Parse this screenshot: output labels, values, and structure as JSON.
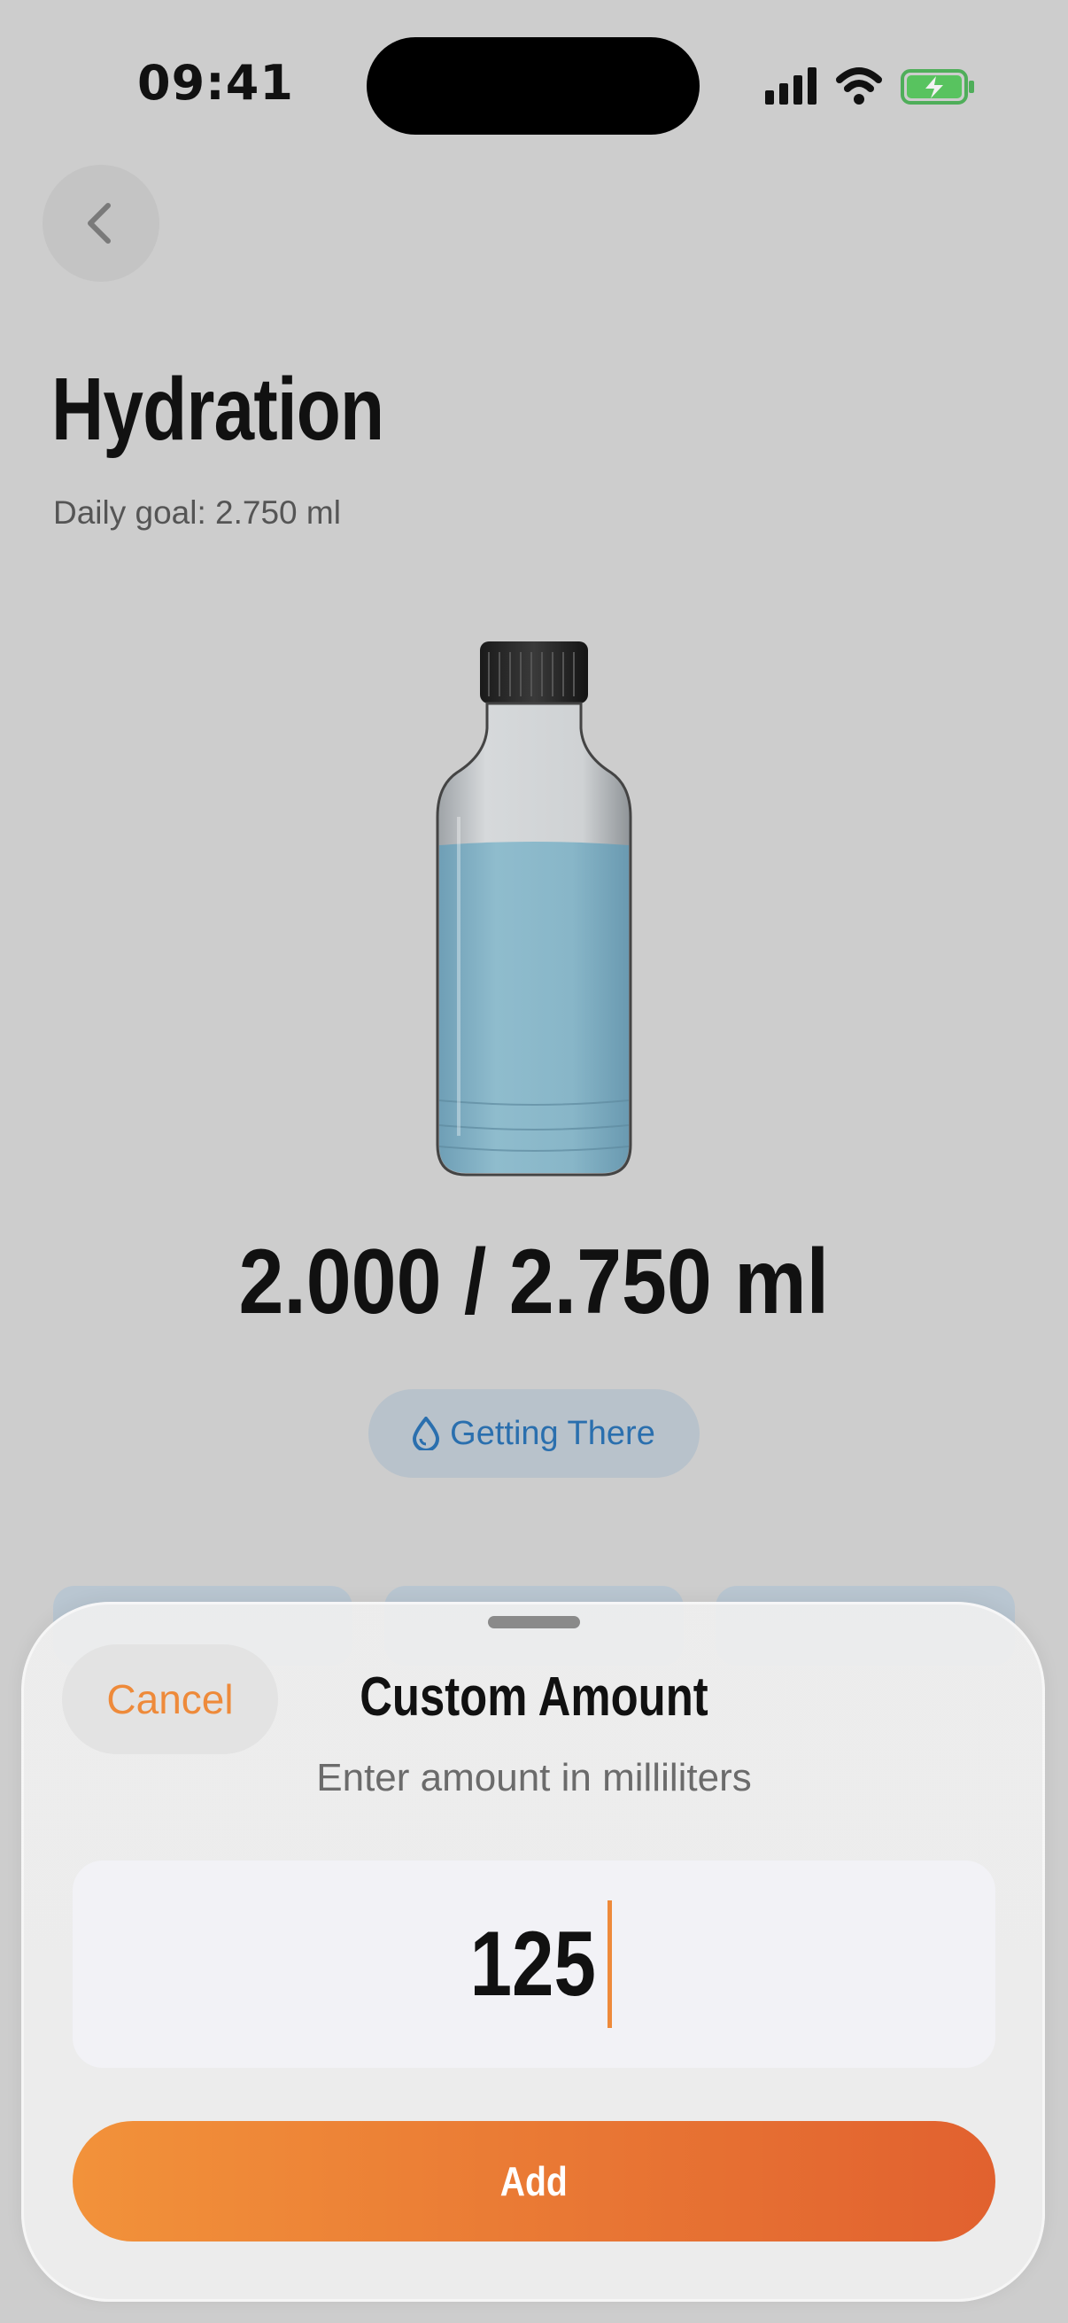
{
  "status_bar": {
    "time": "09:41",
    "icons": [
      "cellular-signal-icon",
      "wifi-icon",
      "battery-charging-icon"
    ]
  },
  "header": {
    "back_icon": "chevron-left-icon",
    "title": "Hydration",
    "subtitle": "Daily goal: 2.750 ml"
  },
  "progress": {
    "amount_text": "2.000 / 2.750 ml",
    "consumed_ml": 2000,
    "goal_ml": 2750,
    "fill_fraction": 0.73
  },
  "status_badge": {
    "icon": "water-drop-icon",
    "label": "Getting There"
  },
  "sheet": {
    "cancel_label": "Cancel",
    "title": "Custom Amount",
    "subtitle": "Enter amount in milliliters",
    "input_value": "125",
    "add_label": "Add"
  },
  "colors": {
    "accent": "#ee8a3a",
    "accent_gradient_end": "#e1612f",
    "badge_text": "#2a6fae",
    "water": "#8ab7cc"
  }
}
